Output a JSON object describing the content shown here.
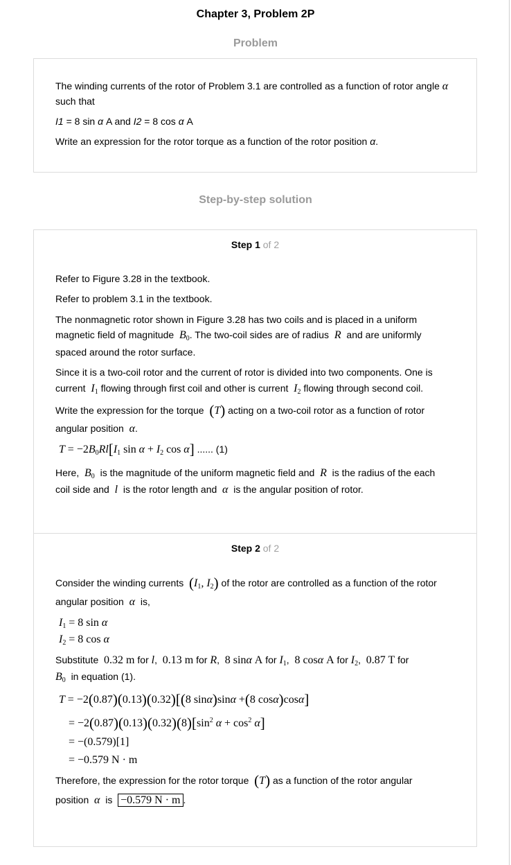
{
  "header": {
    "title": "Chapter 3, Problem 2P",
    "problem_label": "Problem",
    "solution_label": "Step-by-step solution"
  },
  "problem": {
    "line1": "The winding currents of the rotor of Problem 3.1 are controlled as a function of rotor angle ",
    "alpha": "α",
    "line2": "such that",
    "i1": "I1",
    "i1_rest": " = 8 sin ",
    "i1_unit": " A and ",
    "i2": "I2",
    "i2_rest": " = 8 cos ",
    "i2_unit": " A",
    "line4a": "Write an expression for the rotor torque as a function of the rotor position ",
    "line4b": "."
  },
  "step1": {
    "label": "Step 1",
    "of": " of 2",
    "p1": "Refer to Figure 3.28 in the textbook.",
    "p2": "Refer to problem 3.1 in the textbook.",
    "p3a": "The nonmagnetic rotor shown in Figure 3.28 has two coils and is placed in a uniform",
    "p3b": "magnetic field of magnitude",
    "p3c": ". The two-coil sides are of radius",
    "p3d": "and are uniformly",
    "p3e": "spaced around the rotor surface.",
    "p4a": "Since it is a two-coil rotor and the current of rotor is divided into two components. One is",
    "p4b": "current",
    "p4c": "flowing through first coil and other is current",
    "p4d": "flowing through second coil.",
    "p5a": "Write the expression for the torque",
    "p5b": "acting on a two-coil rotor as a function of rotor",
    "p5c": "angular position",
    "eq_tag": "...... (1)",
    "p6a": "Here,",
    "p6b": "is the magnitude of the uniform magnetic field and",
    "p6c": "is the radius of the each",
    "p6d": "coil side and",
    "p6e": "is the rotor length and",
    "p6f": "is the angular position of rotor."
  },
  "step2": {
    "label": "Step 2",
    "of": " of 2",
    "p1a": "Consider the winding currents",
    "p1b": "of the rotor are controlled as a function of the rotor",
    "p1c": "angular position",
    "p1d": "is,",
    "sub_word": "Substitute",
    "v1": "0.32 m",
    "v2": "0.13 m",
    "v3": "8 sin",
    "v3u": "A",
    "v4": "8 cos",
    "v4u": "A",
    "v5": "0.87 T",
    "for": "for",
    "in_eq": "in equation (1).",
    "res3": "= −(0.579)[1]",
    "res4": "= −0.579 N · m",
    "p_end1": "Therefore, the expression for the rotor torque",
    "p_end2": "as a function of the rotor angular",
    "p_end3": "position",
    "p_end4": "is",
    "answer": "−0.579 N · m"
  }
}
